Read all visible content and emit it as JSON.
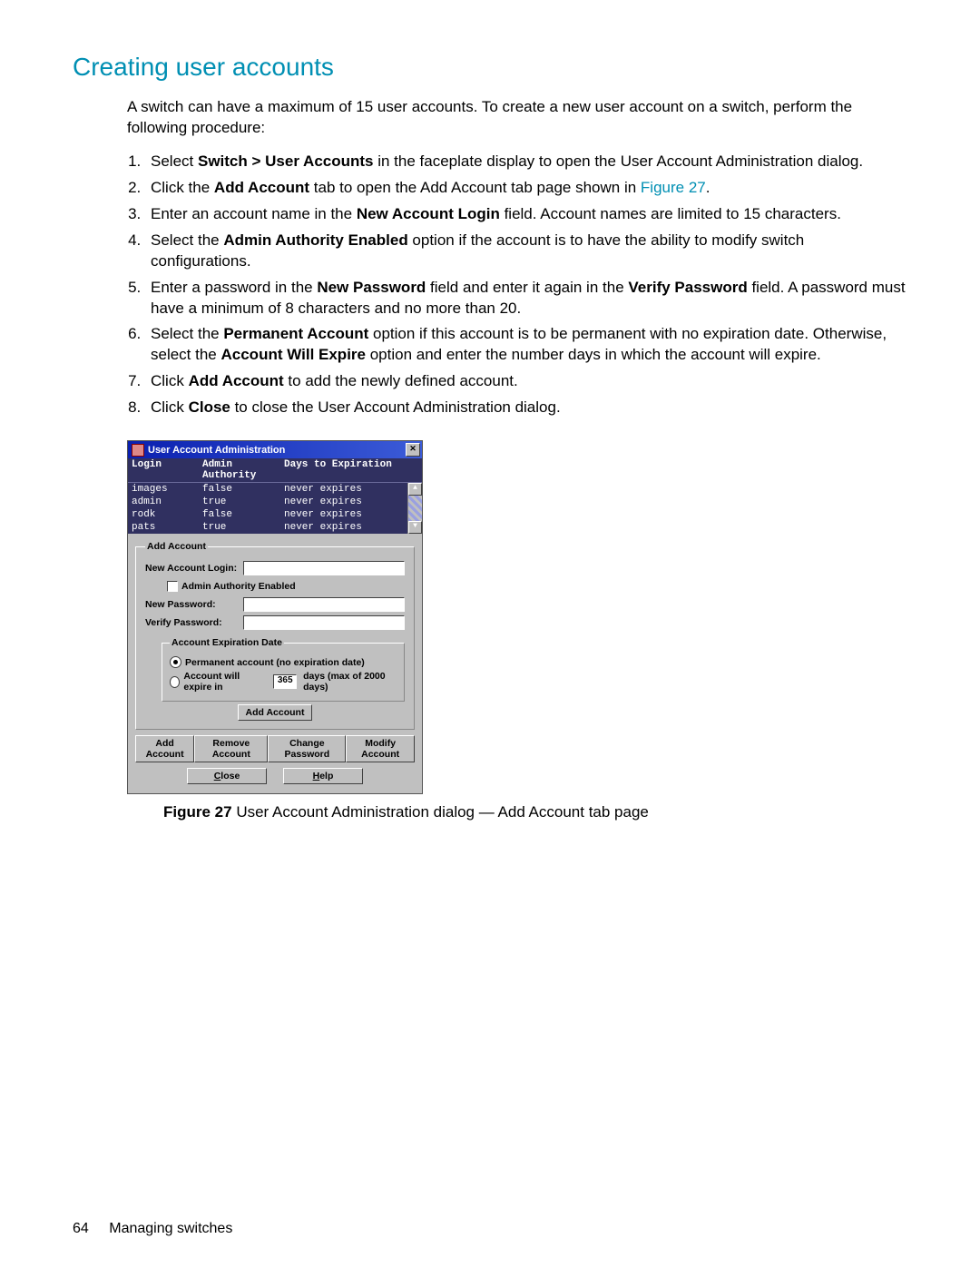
{
  "heading": "Creating user accounts",
  "intro": "A switch can have a maximum of 15 user accounts. To create a new user account on a switch, perform the following procedure:",
  "steps": {
    "s1_a": "Select ",
    "s1_b": "Switch > User Accounts",
    "s1_c": " in the faceplate display to open the User Account Administration dialog.",
    "s2_a": "Click the ",
    "s2_b": "Add Account",
    "s2_c": " tab to open the Add Account tab page shown in ",
    "s2_link": "Figure 27",
    "s2_d": ".",
    "s3_a": "Enter an account name in the ",
    "s3_b": "New Account Login",
    "s3_c": " field. Account names are limited to 15 characters.",
    "s4_a": "Select the ",
    "s4_b": "Admin Authority Enabled",
    "s4_c": " option if the account is to have the ability to modify switch configurations.",
    "s5_a": "Enter a password in the ",
    "s5_b": "New Password",
    "s5_c": " field and enter it again in the ",
    "s5_d": "Verify Password",
    "s5_e": " field. A password must have a minimum of 8 characters and no more than 20.",
    "s6_a": "Select the ",
    "s6_b": "Permanent Account",
    "s6_c": " option if this account is to be permanent with no expiration date. Otherwise, select the ",
    "s6_d": "Account Will Expire",
    "s6_e": " option and enter the number days in which the account will expire.",
    "s7_a": "Click ",
    "s7_b": "Add Account",
    "s7_c": " to add the newly defined account.",
    "s8_a": "Click ",
    "s8_b": "Close",
    "s8_c": " to close the User Account Administration dialog."
  },
  "dialog": {
    "title": "User Account Administration",
    "columns": {
      "login": "Login",
      "auth": "Admin Authority",
      "exp": "Days to Expiration"
    },
    "rows": [
      {
        "login": "images",
        "auth": "false",
        "exp": "never expires"
      },
      {
        "login": "admin",
        "auth": "true",
        "exp": "never expires"
      },
      {
        "login": "rodk",
        "auth": "false",
        "exp": "never expires"
      },
      {
        "login": "pats",
        "auth": "true",
        "exp": "never expires"
      }
    ],
    "group_add": "Add Account",
    "lbl_new_login": "New Account Login:",
    "lbl_admin_enabled": "Admin Authority Enabled",
    "lbl_new_pw": "New Password:",
    "lbl_verify_pw": "Verify Password:",
    "group_exp": "Account Expiration Date",
    "radio_perm": "Permanent account (no expiration date)",
    "radio_expire_a": "Account will expire in",
    "days_value": "365",
    "radio_expire_b": "days (max of 2000 days)",
    "btn_add": "Add Account",
    "tabs": {
      "add": "Add Account",
      "remove": "Remove Account",
      "changepw": "Change Password",
      "modify": "Modify Account"
    },
    "btn_close": "Close",
    "btn_help": "Help"
  },
  "caption_a": "Figure 27",
  "caption_b": "  User Account Administration dialog — Add Account tab page",
  "footer_page": "64",
  "footer_text": "Managing switches"
}
